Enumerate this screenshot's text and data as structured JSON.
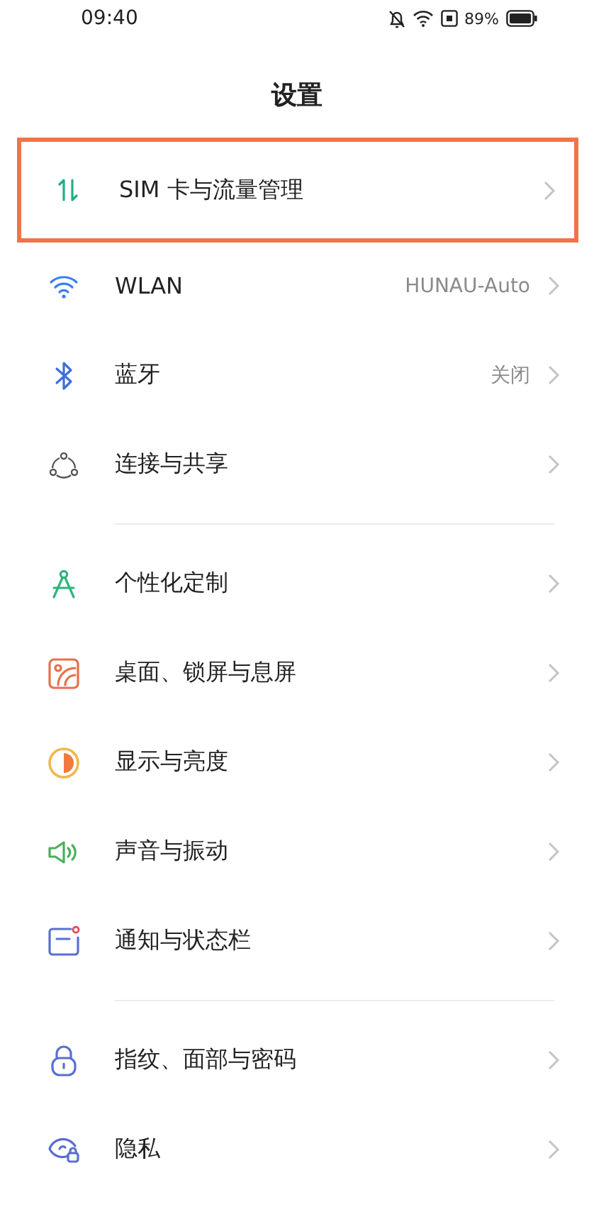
{
  "status_bar": {
    "time": "09:40",
    "battery": "89%"
  },
  "header": {
    "title": "设置"
  },
  "groups": [
    {
      "items": [
        {
          "label": "SIM 卡与流量管理",
          "highlighted": true
        },
        {
          "label": "WLAN",
          "value": "HUNAU-Auto",
          "highlighted": false
        },
        {
          "label": "蓝牙",
          "value": "关闭",
          "highlighted": false
        },
        {
          "label": "连接与共享",
          "highlighted": false
        }
      ]
    },
    {
      "items": [
        {
          "label": "个性化定制",
          "highlighted": false
        },
        {
          "label": "桌面、锁屏与息屏",
          "highlighted": false
        },
        {
          "label": "显示与亮度",
          "highlighted": false
        },
        {
          "label": "声音与振动",
          "highlighted": false
        },
        {
          "label": "通知与状态栏",
          "highlighted": false
        }
      ]
    },
    {
      "items": [
        {
          "label": "指纹、面部与密码",
          "highlighted": false
        },
        {
          "label": "隐私",
          "highlighted": false
        }
      ]
    }
  ]
}
